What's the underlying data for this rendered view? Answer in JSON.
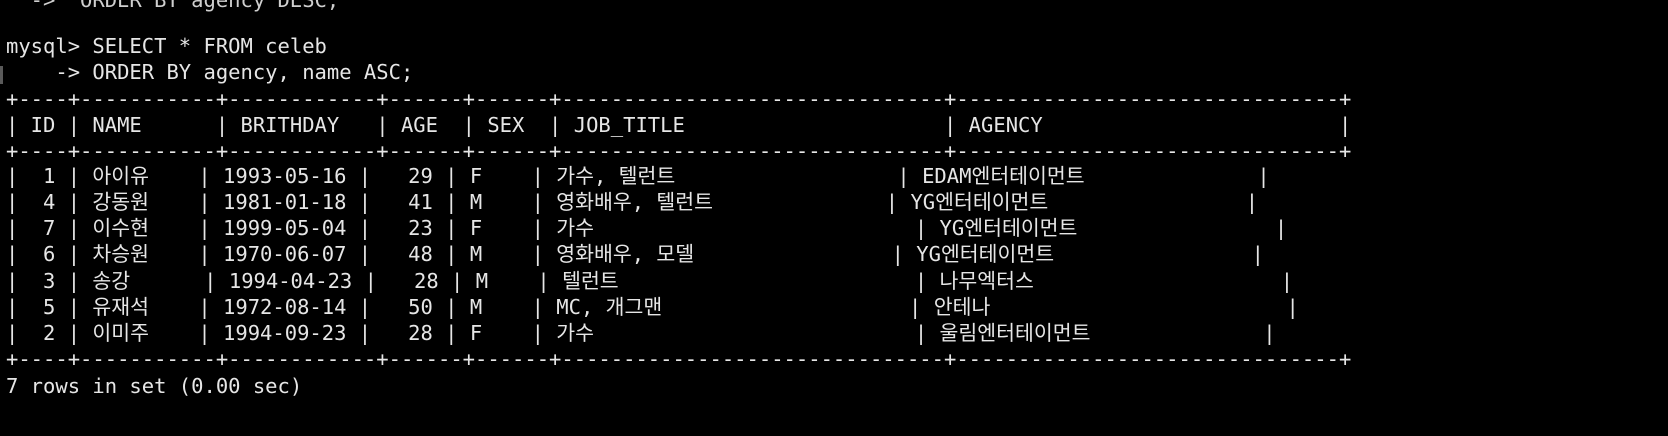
{
  "terminal": {
    "prev_line": "  ->  ORDER BY agency DESC;",
    "prompt": "mysql> SELECT * FROM celeb",
    "continuation": "    -> ORDER BY agency, name ASC;",
    "footer": "7 rows in set (0.00 sec)"
  },
  "table": {
    "border": "+----+-----------+------------+------+------+-------------------------------+-------------------------------+",
    "header": "| ID | NAME      | BRITHDAY   | AGE  | SEX  | JOB_TITLE                     | AGENCY                        |",
    "rows": [
      "|  1 | 아이유    | 1993-05-16 |   29 | F    | 가수, 텔런트                  | EDAM엔터테이먼트              |",
      "|  4 | 강동원    | 1981-01-18 |   41 | M    | 영화배우, 텔런트              | YG엔터테이먼트                |",
      "|  7 | 이수현    | 1999-05-04 |   23 | F    | 가수                          | YG엔터테이먼트                |",
      "|  6 | 차승원    | 1970-06-07 |   48 | M    | 영화배우, 모델                | YG엔터테이먼트                |",
      "|  3 | 송강      | 1994-04-23 |   28 | M    | 텔런트                        | 나무엑터스                    |",
      "|  5 | 유재석    | 1972-08-14 |   50 | M    | MC, 개그맨                    | 안테나                        |",
      "|  2 | 이미주    | 1994-09-23 |   28 | F    | 가수                          | 울림엔터테이먼트              |"
    ]
  }
}
